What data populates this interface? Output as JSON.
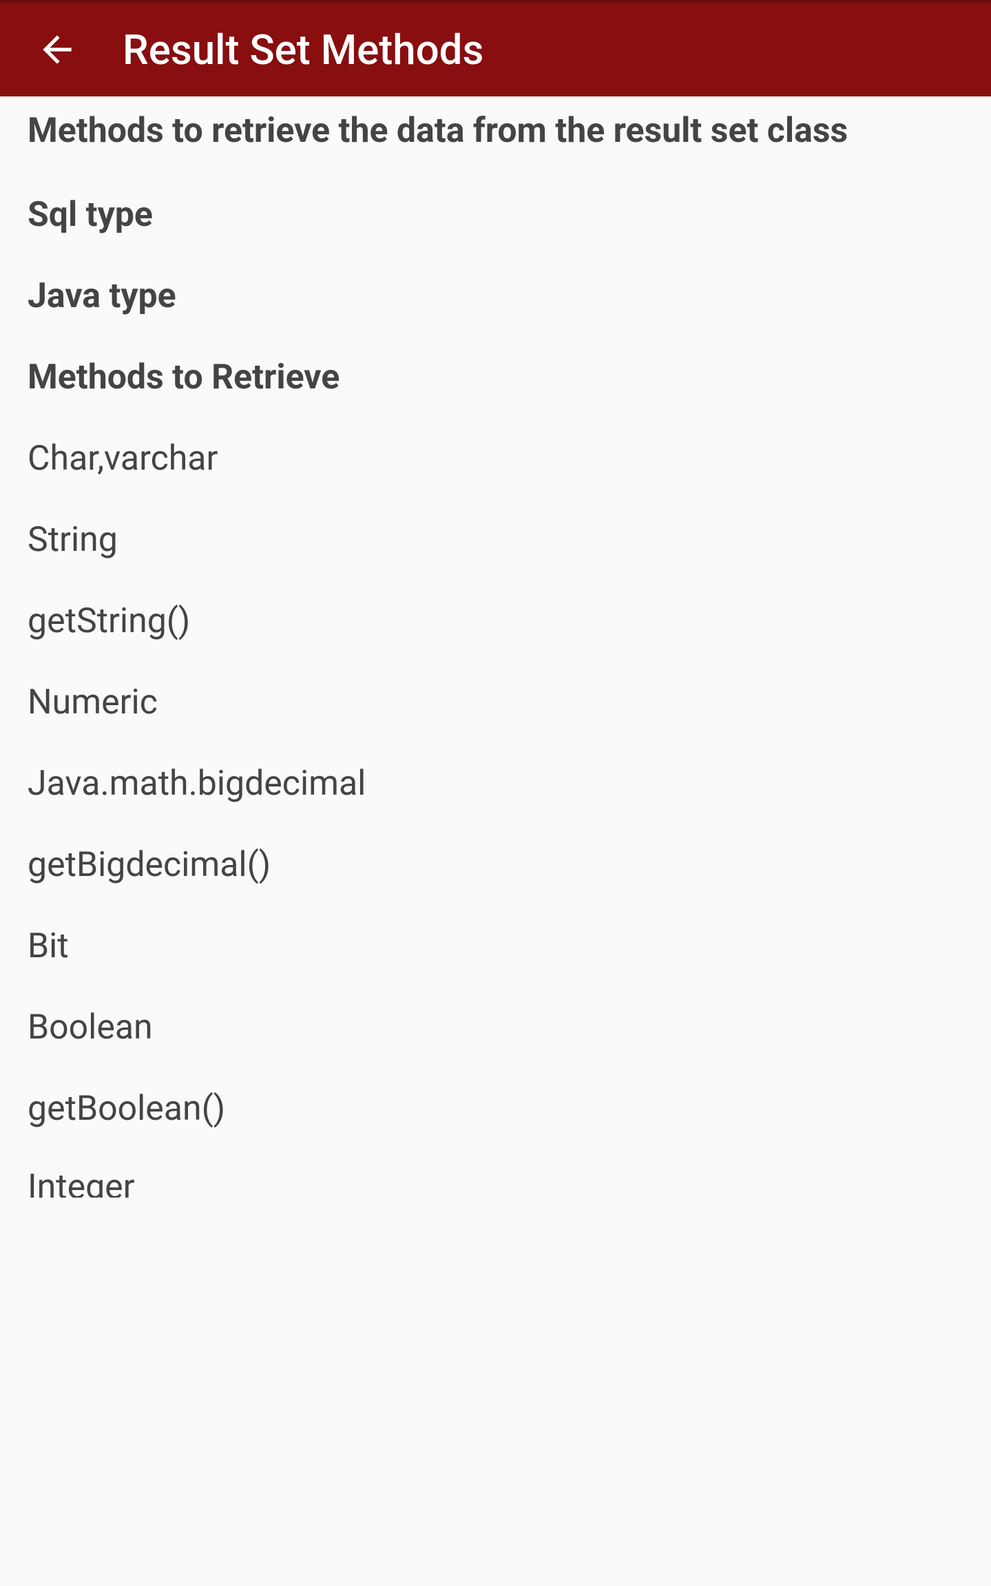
{
  "header": {
    "title": "Result Set Methods"
  },
  "content": {
    "intro": "Methods to retrieve the data from the result set class",
    "columns": {
      "sql_type": "Sql type",
      "java_type": "Java type",
      "methods": "Methods to Retrieve"
    },
    "items": [
      "Char,varchar",
      "String",
      "getString()",
      "Numeric",
      "Java.math.bigdecimal",
      "getBigdecimal()",
      "Bit",
      "Boolean",
      "getBoolean()"
    ],
    "partial_item": "Integer"
  }
}
